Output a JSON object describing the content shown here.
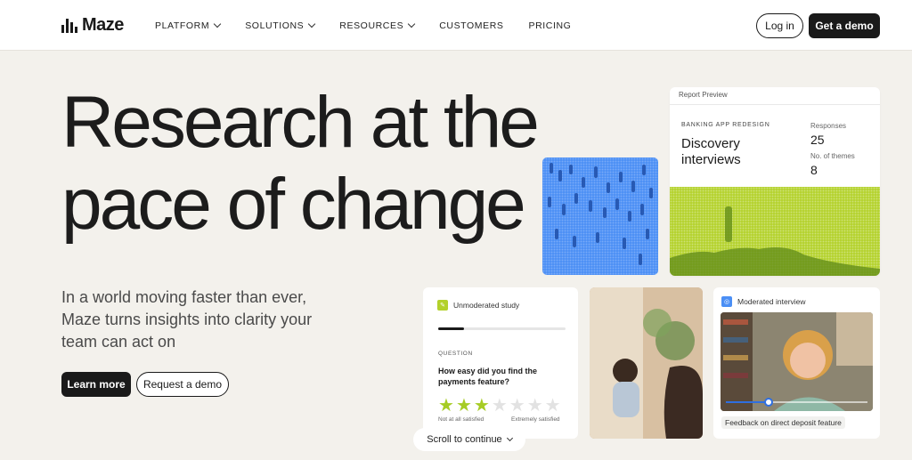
{
  "nav": {
    "brand": "Maze",
    "menu": [
      {
        "label": "PLATFORM",
        "dropdown": true
      },
      {
        "label": "SOLUTIONS",
        "dropdown": true
      },
      {
        "label": "RESOURCES",
        "dropdown": true
      },
      {
        "label": "CUSTOMERS",
        "dropdown": false
      },
      {
        "label": "PRICING",
        "dropdown": false
      }
    ],
    "login_label": "Log in",
    "demo_label": "Get a demo"
  },
  "hero": {
    "title_line1": "Research at the",
    "title_line2": "pace of change",
    "subtitle": "In a world moving faster than ever, Maze turns insights into clarity your team can act on",
    "learn_more_label": "Learn more",
    "request_demo_label": "Request a demo"
  },
  "report": {
    "header": "Report Preview",
    "project_label": "BANKING APP REDESIGN",
    "title": "Discovery interviews",
    "responses_label": "Responses",
    "responses_value": "25",
    "themes_label": "No. of themes",
    "themes_value": "8"
  },
  "study": {
    "tag": "Unmoderated study",
    "progress": 0.2,
    "question_label": "QUESTION",
    "question_text": "How easy did you find the payments feature?",
    "rating": 3,
    "rating_max": 7,
    "scale_low": "Not at all satisfied",
    "scale_high": "Extremely satisfied"
  },
  "interview": {
    "tag": "Moderated interview",
    "progress": 0.3,
    "caption": "Feedback on direct deposit feature"
  },
  "scroll": {
    "label": "Scroll to continue"
  },
  "colors": {
    "background": "#f3f1ec",
    "dark": "#1a1a1a",
    "lime": "#b4d22c",
    "blue": "#4b8ff5"
  },
  "icons": [
    "chevron-down-icon",
    "study-icon",
    "interview-icon",
    "star-icon"
  ]
}
